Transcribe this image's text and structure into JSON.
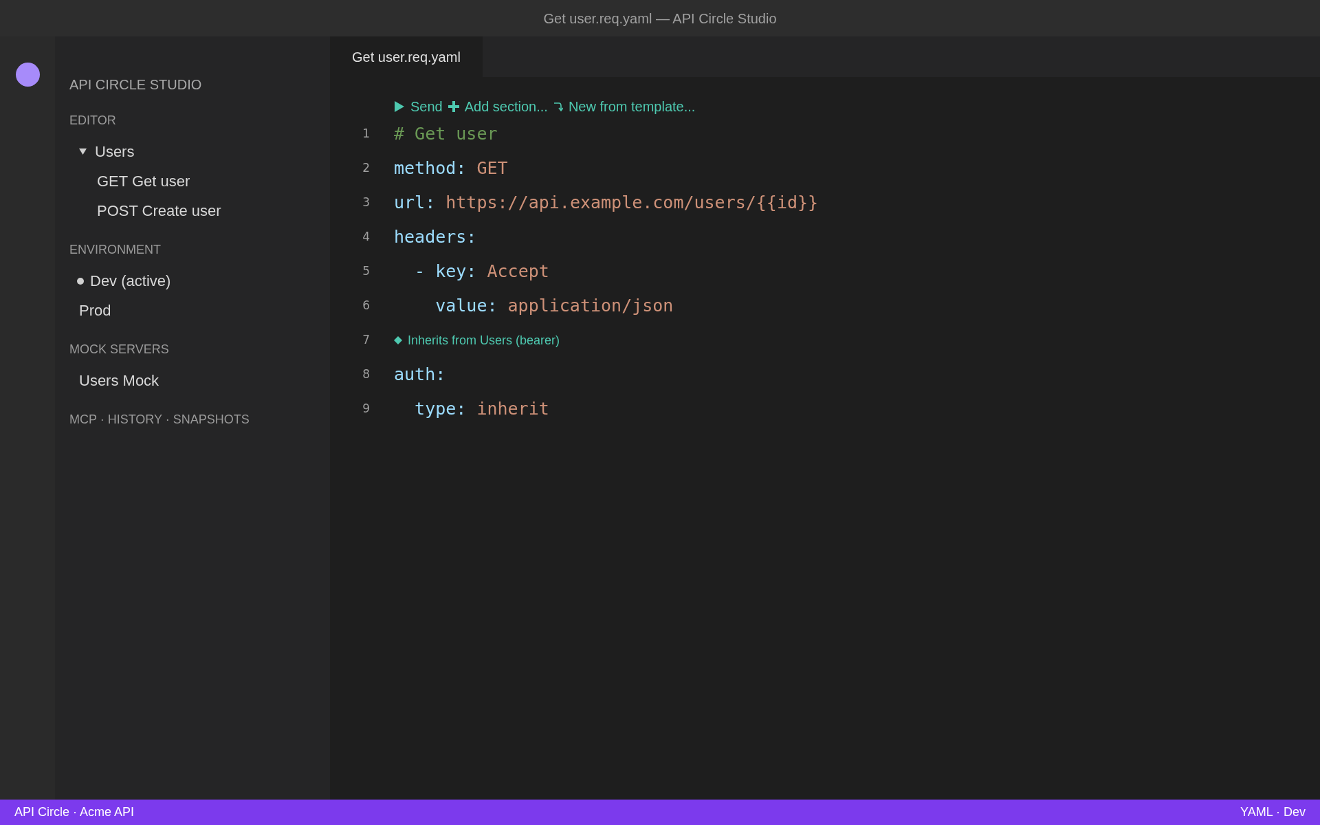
{
  "window": {
    "title": "Get user.req.yaml — API Circle Studio"
  },
  "sidebar": {
    "title": "API CIRCLE STUDIO",
    "sections": [
      {
        "heading": "EDITOR",
        "items": [
          {
            "label": "Users",
            "expanded": true,
            "children": [
              {
                "label": "GET Get user"
              },
              {
                "label": "POST Create user"
              }
            ]
          }
        ]
      },
      {
        "heading": "ENVIRONMENT",
        "items": [
          {
            "label": "Dev (active)",
            "active": true
          },
          {
            "label": "Prod",
            "active": false
          }
        ]
      },
      {
        "heading": "MOCK SERVERS",
        "items": [
          {
            "label": "Users Mock"
          }
        ]
      },
      {
        "heading": "MCP · HISTORY · SNAPSHOTS"
      }
    ]
  },
  "tabs": [
    {
      "label": "Get user.req.yaml",
      "selected": true
    }
  ],
  "editor": {
    "actions": [
      {
        "kind": "play",
        "label": "Send"
      },
      {
        "kind": "plus",
        "label": "Add section..."
      },
      {
        "kind": "turn",
        "label": "New from template..."
      }
    ],
    "lines": [
      {
        "number": "1",
        "tokens": [
          {
            "kind": "comment",
            "text": "# Get user"
          }
        ]
      },
      {
        "number": "2",
        "tokens": [
          {
            "kind": "key",
            "text": "method:"
          },
          {
            "kind": "value",
            "text": " GET"
          }
        ]
      },
      {
        "number": "3",
        "tokens": [
          {
            "kind": "key",
            "text": "url:"
          },
          {
            "kind": "value",
            "text": " https://api.example.com/users/{{id}}"
          }
        ]
      },
      {
        "number": "4",
        "tokens": [
          {
            "kind": "key",
            "text": "headers:"
          }
        ]
      },
      {
        "number": "5",
        "tokens": [
          {
            "kind": "key",
            "text": "  - key:"
          },
          {
            "kind": "value",
            "text": " Accept"
          }
        ]
      },
      {
        "number": "6",
        "tokens": [
          {
            "kind": "key",
            "text": "    value:"
          },
          {
            "kind": "value",
            "text": " application/json"
          }
        ]
      },
      {
        "number": "7",
        "lens": "Inherits from Users (bearer)"
      },
      {
        "number": "8",
        "tokens": [
          {
            "kind": "key",
            "text": "auth:"
          }
        ]
      },
      {
        "number": "9",
        "tokens": [
          {
            "kind": "key",
            "text": "  type:"
          },
          {
            "kind": "value",
            "text": " inherit"
          }
        ]
      }
    ]
  },
  "status_bar": {
    "left": "API Circle · Acme API",
    "right": "YAML · Dev"
  }
}
